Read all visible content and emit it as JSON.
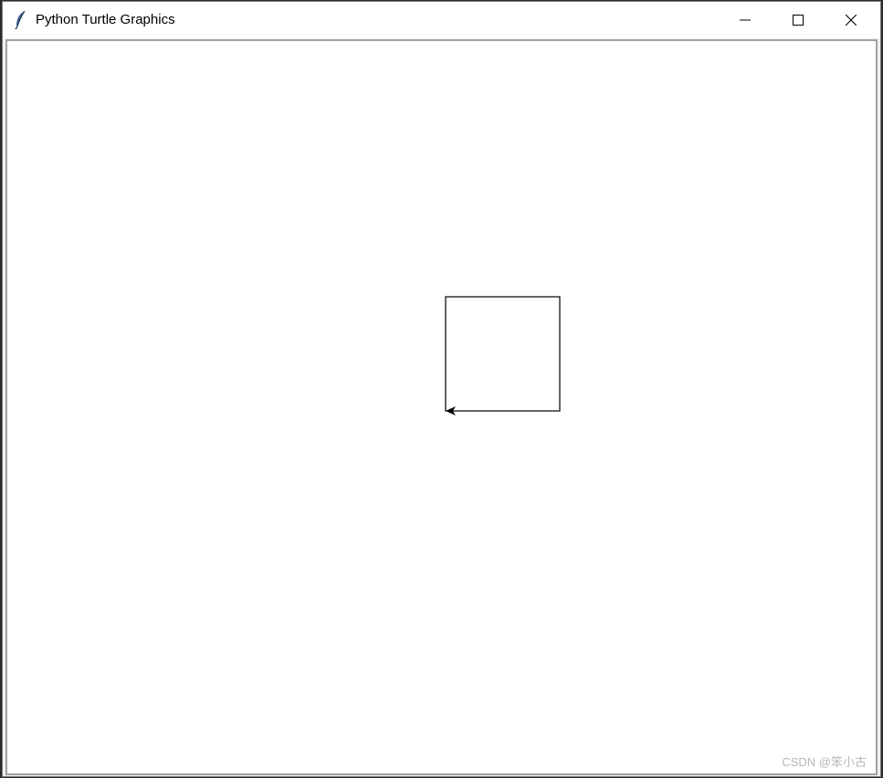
{
  "window": {
    "title": "Python Turtle Graphics"
  },
  "titlebar_buttons": {
    "minimize": "minimize-icon",
    "maximize": "maximize-icon",
    "close": "close-icon"
  },
  "app_icon": "feather-icon",
  "drawing": {
    "shape": "square",
    "side_length": 125,
    "pen_color": "#000000",
    "turtle_heading": "west",
    "turtle_icon": "arrow-turtle-icon"
  },
  "watermark": {
    "text": "CSDN @笨小古"
  }
}
